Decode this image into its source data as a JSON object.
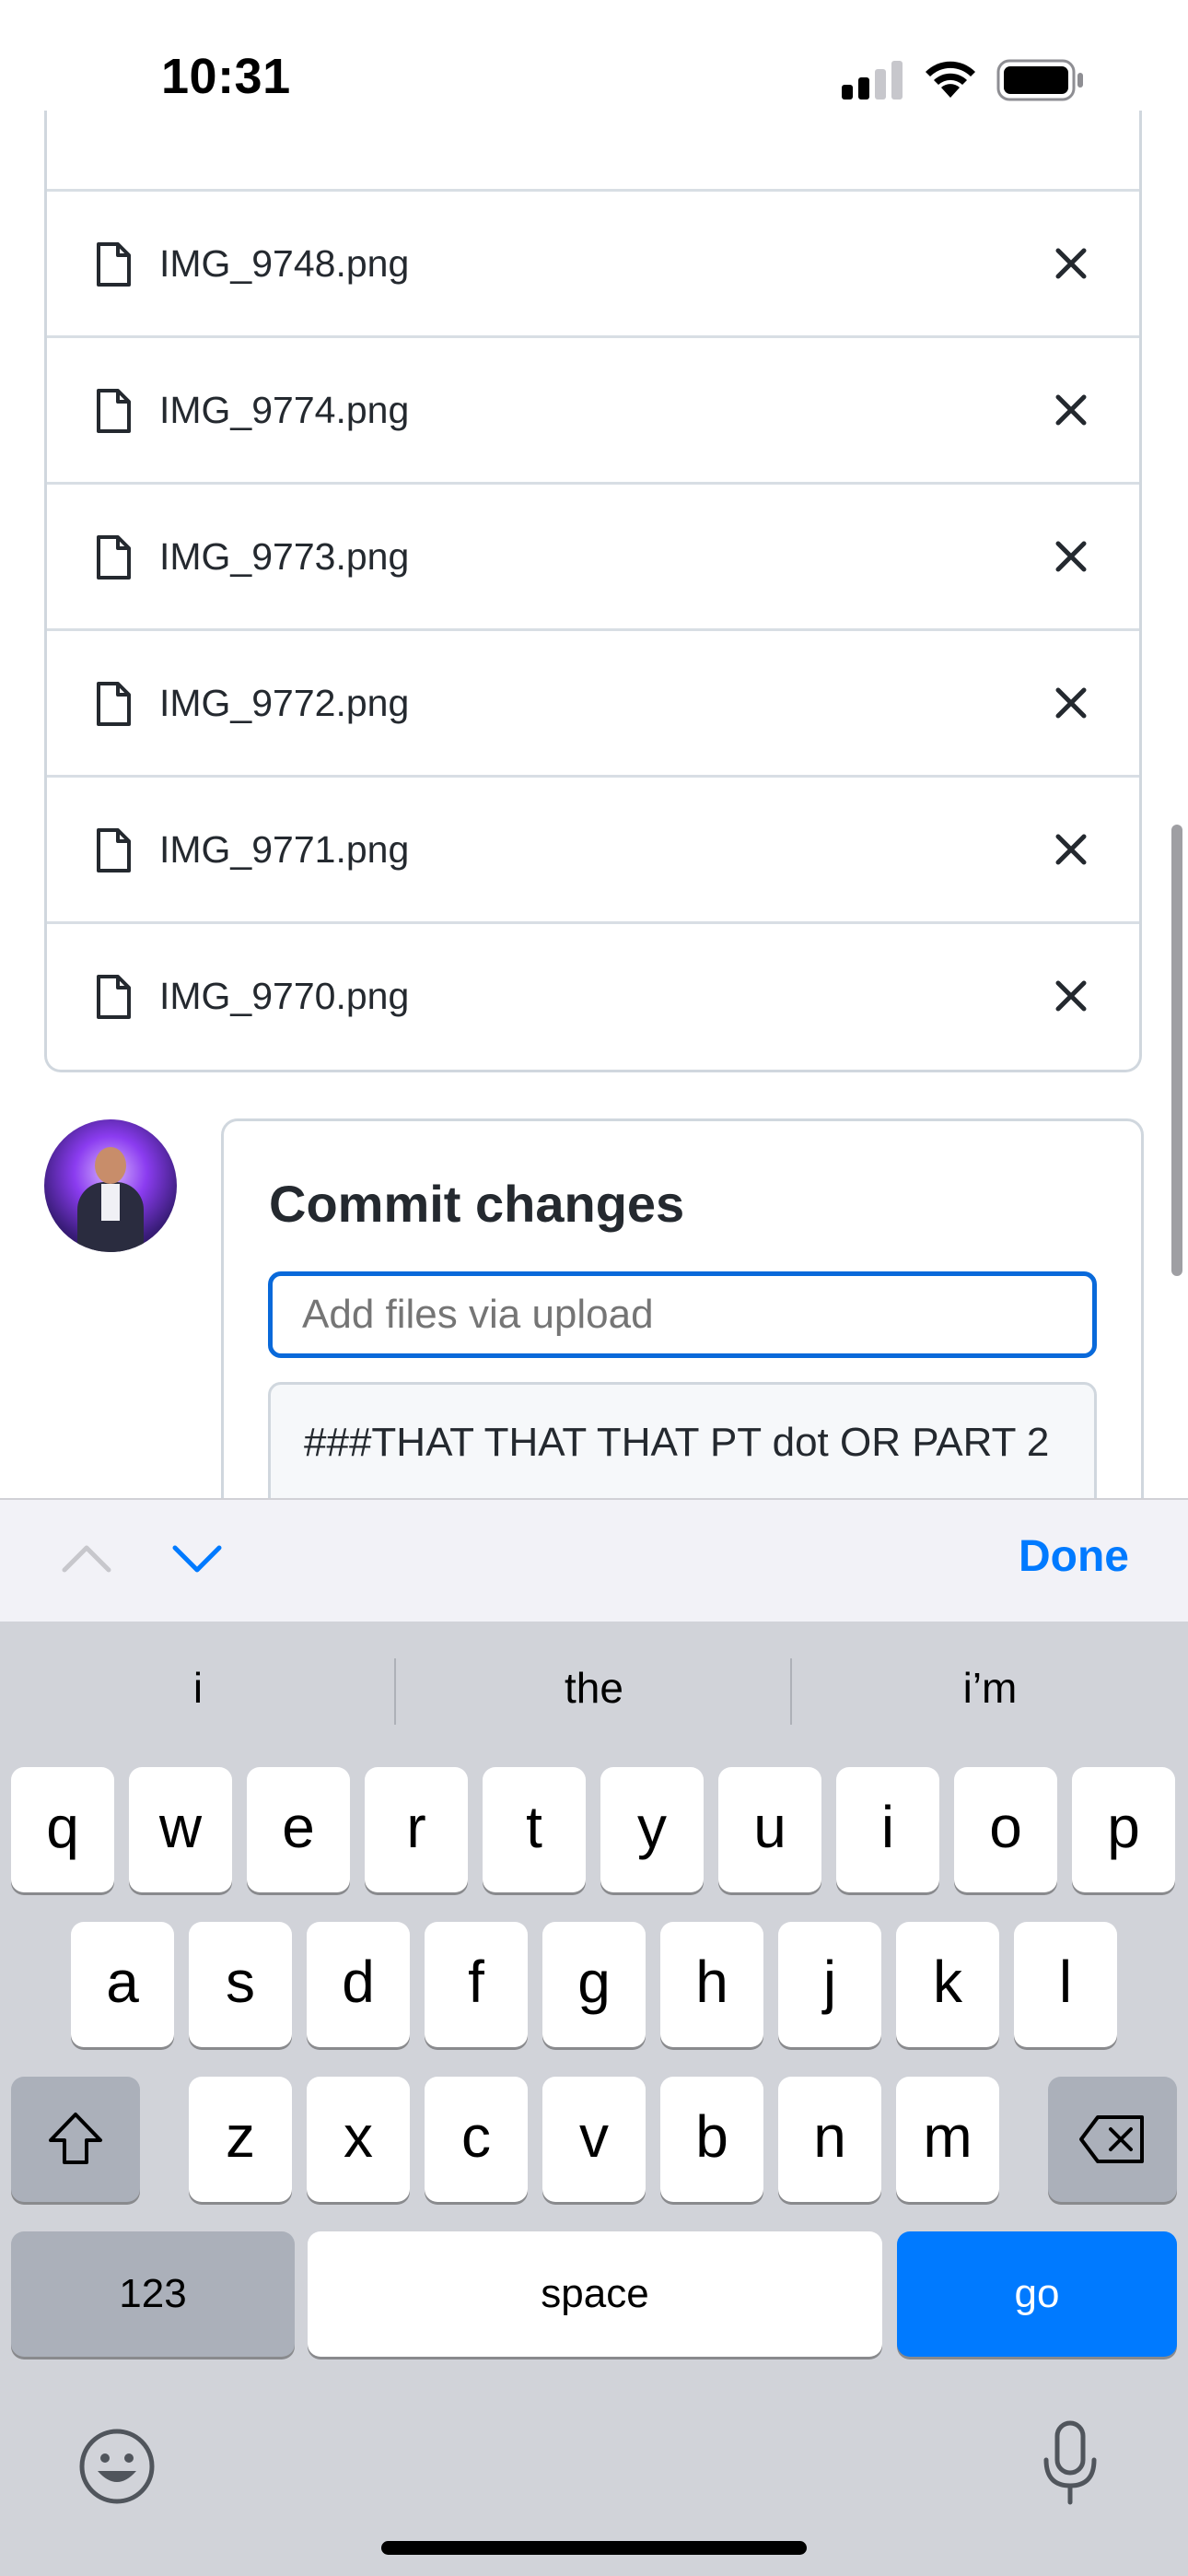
{
  "status_bar": {
    "time": "10:31"
  },
  "files": [
    {
      "name": "IMG_9748.png"
    },
    {
      "name": "IMG_9774.png"
    },
    {
      "name": "IMG_9773.png"
    },
    {
      "name": "IMG_9772.png"
    },
    {
      "name": "IMG_9771.png"
    },
    {
      "name": "IMG_9770.png"
    }
  ],
  "commit": {
    "title": "Commit changes",
    "summary_placeholder": "Add files via upload",
    "description_value": "###THAT THAT THAT PT dot OR PART 2"
  },
  "accessory": {
    "done_label": "Done"
  },
  "keyboard": {
    "suggestions": [
      "i",
      "the",
      "i’m"
    ],
    "row1": [
      "q",
      "w",
      "e",
      "r",
      "t",
      "y",
      "u",
      "i",
      "o",
      "p"
    ],
    "row2": [
      "a",
      "s",
      "d",
      "f",
      "g",
      "h",
      "j",
      "k",
      "l"
    ],
    "row3": [
      "z",
      "x",
      "c",
      "v",
      "b",
      "n",
      "m"
    ],
    "numbers_label": "123",
    "space_label": "space",
    "go_label": "go"
  },
  "colors": {
    "accent": "#007aff",
    "focus_border": "#0969da",
    "keyboard_bg": "#d1d3d9"
  },
  "icons": [
    "file-icon",
    "close-icon",
    "chevron-up-icon",
    "chevron-down-icon",
    "shift-icon",
    "backspace-icon",
    "emoji-icon",
    "microphone-icon",
    "signal-icon",
    "wifi-icon",
    "battery-icon"
  ]
}
